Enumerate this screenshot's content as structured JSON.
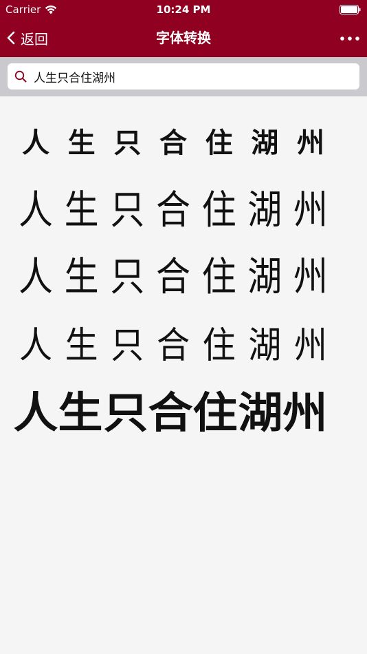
{
  "status_bar": {
    "carrier": "Carrier",
    "time": "10:24 PM"
  },
  "nav": {
    "back_label": "返回",
    "title": "字体转换"
  },
  "search": {
    "value": "人生只合住湖州"
  },
  "font_rows": [
    {
      "glyphs": [
        "人",
        "生",
        "只",
        "合",
        "住",
        "湖",
        "州"
      ]
    },
    {
      "glyphs": [
        "人",
        "生",
        "只",
        "合",
        "住",
        "湖",
        "州"
      ]
    },
    {
      "glyphs": [
        "人",
        "生",
        "只",
        "合",
        "住",
        "湖",
        "州"
      ]
    },
    {
      "glyphs": [
        "人",
        "生",
        "只",
        "合",
        "住",
        "湖",
        "州"
      ]
    },
    {
      "glyphs": [
        "人",
        "生",
        "只",
        "合",
        "住",
        "湖",
        "州"
      ]
    }
  ],
  "colors": {
    "nav_background": "#8f0021",
    "search_background": "#c9c9ce",
    "page_background": "#f5f5f5",
    "search_icon": "#8f0021"
  },
  "icons": {
    "wifi": "wifi-icon",
    "battery": "battery-icon",
    "back": "chevron-left-icon",
    "more": "more-horizontal-icon",
    "search": "search-icon"
  }
}
